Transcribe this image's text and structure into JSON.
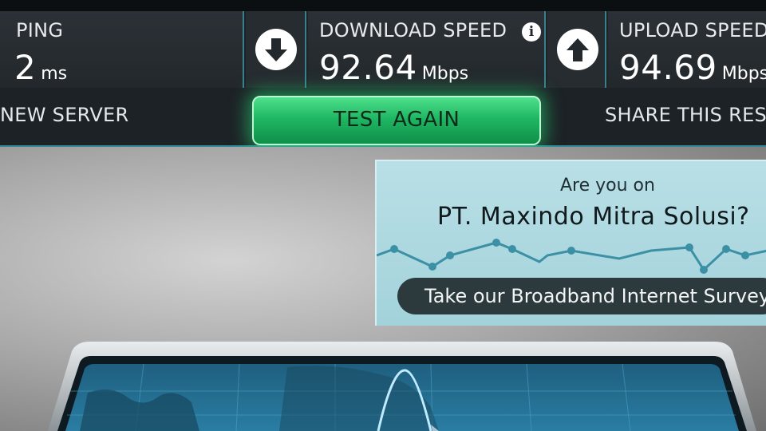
{
  "stats": {
    "ping": {
      "label": "PING",
      "value": "2",
      "unit": "ms"
    },
    "download": {
      "label": "DOWNLOAD SPEED",
      "value": "92.64",
      "unit": "Mbps",
      "icon": "arrow-down-circle-icon"
    },
    "upload": {
      "label": "UPLOAD SPEED",
      "value": "94.69",
      "unit": "Mbps",
      "icon": "arrow-up-circle-icon"
    },
    "info_icon": "i"
  },
  "actions": {
    "new_server": "NEW SERVER",
    "test_again": "TEST AGAIN",
    "share": "SHARE THIS RESULT"
  },
  "isp_ad": {
    "question": "Are you on",
    "isp_name": "PT. Maxindo Mitra Solusi?",
    "survey_button": "Take our Broadband Internet Survey!"
  },
  "colors": {
    "accent_green": "#1fb763",
    "accent_teal": "#2f8a98",
    "ad_panel": "#a3d2db"
  }
}
